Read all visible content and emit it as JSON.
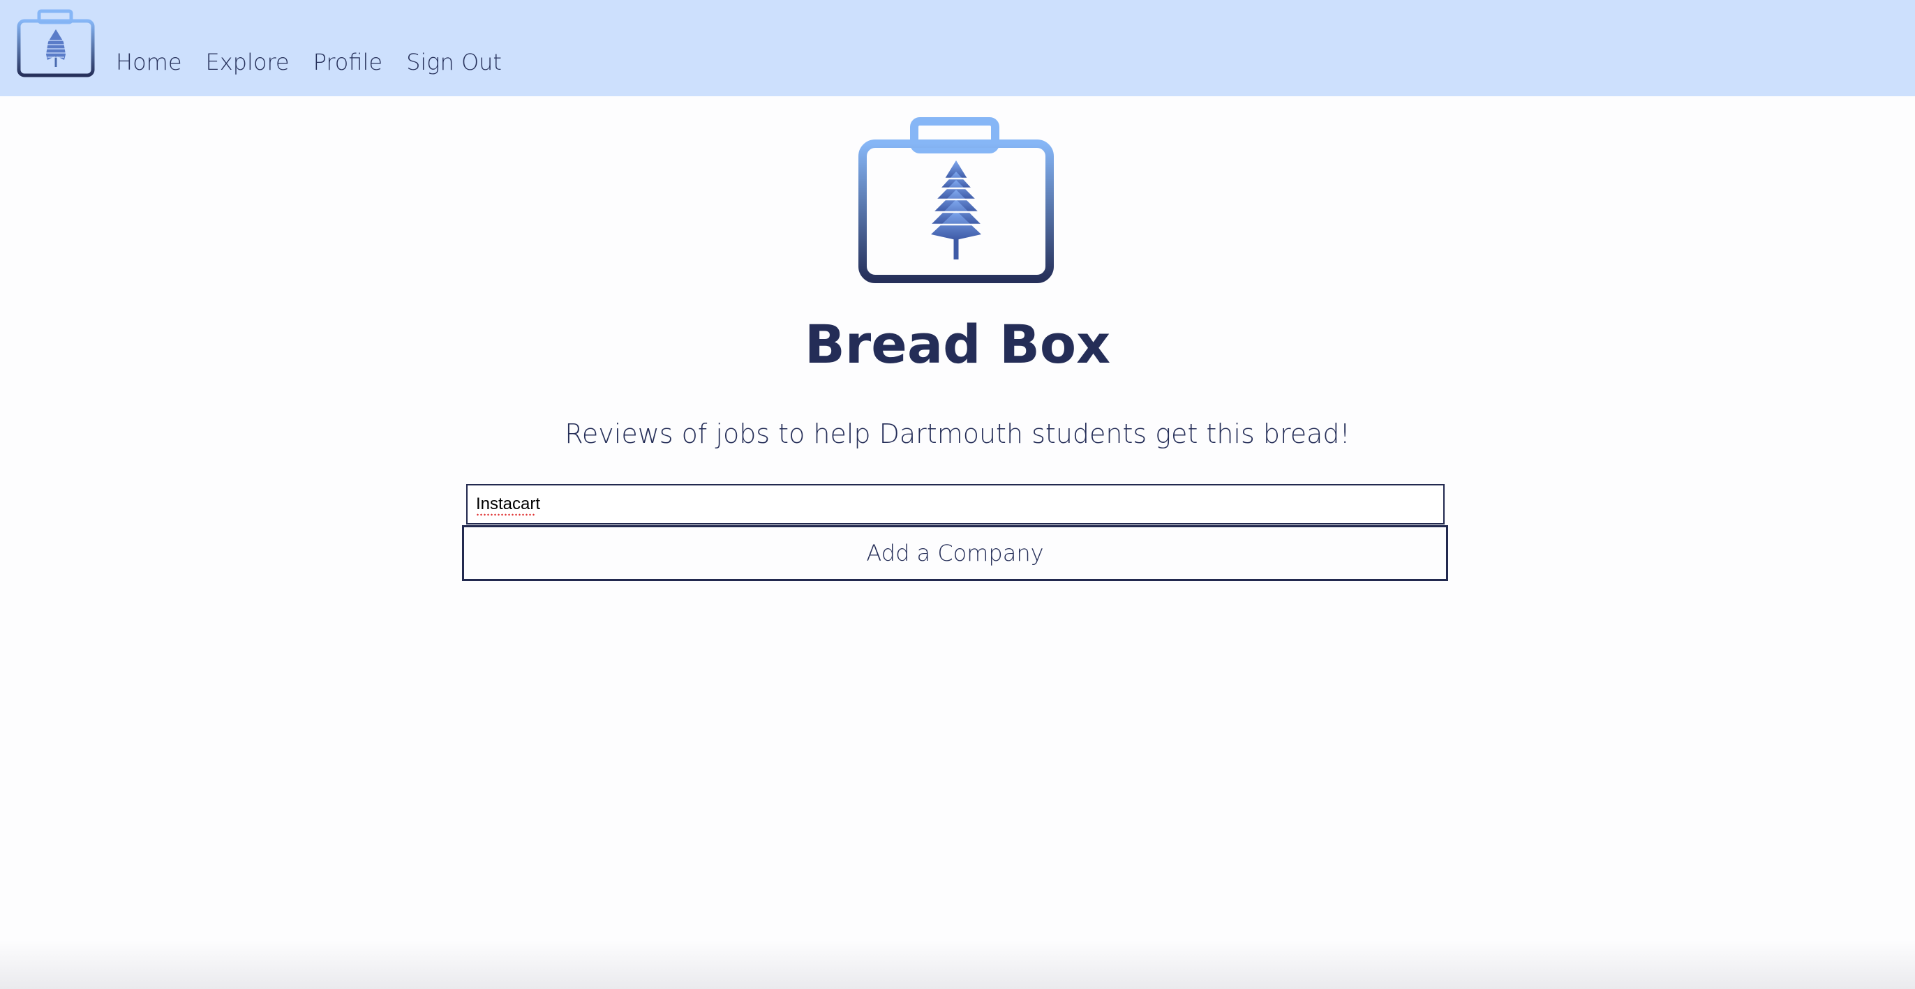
{
  "nav": {
    "logo_icon": "briefcase-tree-logo-icon",
    "links": [
      {
        "label": "Home"
      },
      {
        "label": "Explore"
      },
      {
        "label": "Profile"
      },
      {
        "label": "Sign Out"
      }
    ]
  },
  "hero": {
    "logo_icon": "briefcase-tree-logo-icon",
    "title": "Bread Box",
    "subtitle": "Reviews of jobs to help Dartmouth students get this bread!"
  },
  "form": {
    "company_input_value": "Instacart",
    "add_button_label": "Add a Company"
  },
  "colors": {
    "navbar_bg": "#cde0fd",
    "primary_text": "#242d57",
    "logo_light_blue": "#86b6f6",
    "logo_dark_navy": "#26305a"
  }
}
